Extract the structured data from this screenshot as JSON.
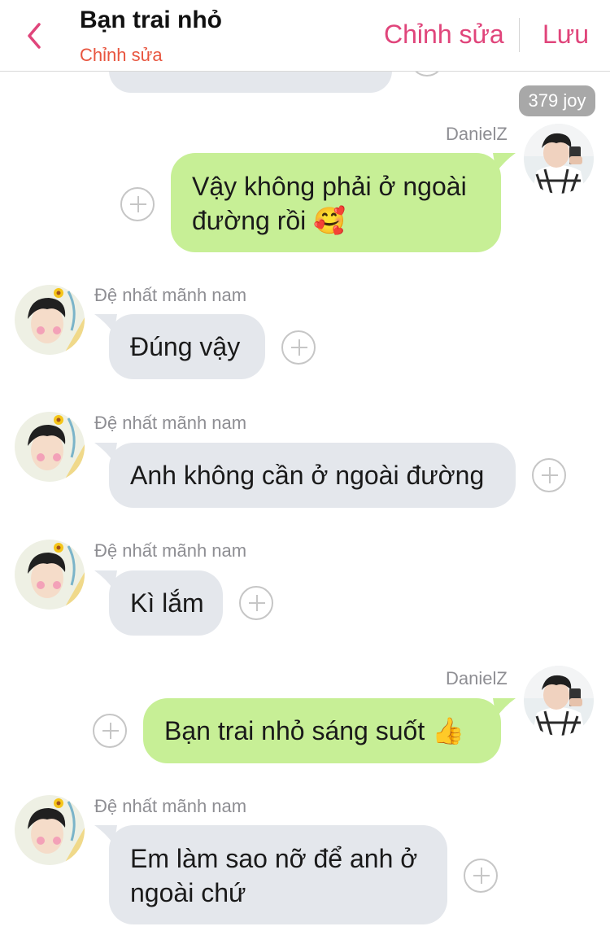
{
  "header": {
    "title": "Bạn trai nhỏ",
    "subtitle": "Chỉnh sửa",
    "edit_label": "Chỉnh sửa",
    "save_label": "Lưu"
  },
  "badge": "379 joy",
  "colors": {
    "accent": "#e0457b",
    "subtitle": "#e8553f",
    "incoming_bubble": "#e4e7ec",
    "outgoing_bubble": "#c7ef96"
  },
  "messages": [
    {
      "direction": "out",
      "sender": "DanielZ",
      "line1": "Vậy không phải ở ngoài",
      "line2": "đường rồi",
      "emoji": "🥰"
    },
    {
      "direction": "in",
      "sender": "Đệ nhất mãnh nam",
      "text": "Đúng vậy"
    },
    {
      "direction": "in",
      "sender": "Đệ nhất mãnh nam",
      "text": "Anh không cần ở ngoài đường"
    },
    {
      "direction": "in",
      "sender": "Đệ nhất mãnh nam",
      "text": "Kì lắm"
    },
    {
      "direction": "out",
      "sender": "DanielZ",
      "text": "Bạn trai nhỏ sáng suốt",
      "emoji": "👍"
    },
    {
      "direction": "in",
      "sender": "Đệ nhất mãnh nam",
      "line1": "Em làm sao nỡ để anh ở",
      "line2": "ngoài chứ"
    }
  ]
}
